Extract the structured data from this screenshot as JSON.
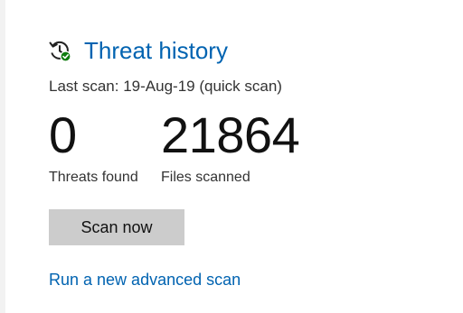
{
  "threat_history": {
    "title": "Threat history",
    "icon": "history-check-icon",
    "last_scan": "Last scan: 19-Aug-19 (quick scan)",
    "stats": [
      {
        "value": "0",
        "label": "Threats found"
      },
      {
        "value": "21864",
        "label": "Files scanned"
      }
    ],
    "scan_now_label": "Scan now",
    "advanced_scan_link": "Run a new advanced scan"
  },
  "colors": {
    "accent": "#0063b1",
    "button_bg": "#cccccc",
    "check_badge": "#107c10"
  }
}
